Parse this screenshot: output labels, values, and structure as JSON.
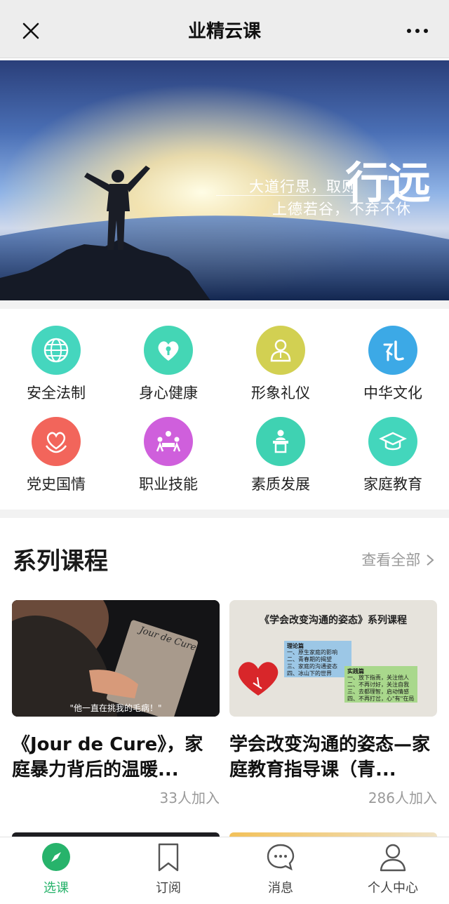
{
  "header": {
    "title": "业精云课",
    "close_icon": "close-icon",
    "more_icon": "more-dots-icon"
  },
  "banner": {
    "line1": "大道行思，取则",
    "line2": "上德若谷，不弃不休",
    "big_text": "行远"
  },
  "categories": [
    {
      "label": "安全法制",
      "icon": "globe-icon",
      "color": "#45d6be"
    },
    {
      "label": "身心健康",
      "icon": "heart-keyhole-icon",
      "color": "#44d6b5"
    },
    {
      "label": "形象礼仪",
      "icon": "person-icon",
      "color": "#d2d052"
    },
    {
      "label": "中华文化",
      "icon": "li-character-icon",
      "color": "#3ca9e6"
    },
    {
      "label": "党史国情",
      "icon": "heart-hands-icon",
      "color": "#f2655b"
    },
    {
      "label": "职业技能",
      "icon": "meeting-icon",
      "color": "#cf5fdc"
    },
    {
      "label": "素质发展",
      "icon": "podium-icon",
      "color": "#3fd2b2"
    },
    {
      "label": "家庭教育",
      "icon": "graduation-cap-icon",
      "color": "#43d6bc"
    }
  ],
  "series": {
    "title": "系列课程",
    "view_all": "查看全部",
    "courses": [
      {
        "title": "《Jour de Cure》，家庭暴力背后的温暖...",
        "joined": "33人加入",
        "thumb_caption": "\"他一直在挑我的毛病！\"",
        "book_text": "Jour de Cure"
      },
      {
        "title": "学会改变沟通的姿态—家庭教育指导课（青...",
        "joined": "286人加入",
        "thumb_heading": "《学会改变沟通的姿态》系列课程",
        "theory_title": "理论篇",
        "theory_items": [
          "一、原生家庭的影响",
          "二、青春期的揭望",
          "三、家庭的沟通姿态",
          "四、冰山下的世界"
        ],
        "practice_title": "实践篇",
        "practice_items": [
          "一、放下指责，关注他人",
          "二、不再讨好，关注自我",
          "三、去都理智，启动情感",
          "四、不再打岔，心\"有\"在局"
        ]
      }
    ]
  },
  "tabbar": {
    "active": 0,
    "tabs": [
      {
        "label": "选课",
        "icon": "compass-icon"
      },
      {
        "label": "订阅",
        "icon": "bookmark-icon"
      },
      {
        "label": "消息",
        "icon": "chat-bubble-icon"
      },
      {
        "label": "个人中心",
        "icon": "user-icon"
      }
    ]
  },
  "colors": {
    "accent": "#27b36b",
    "muted": "#9a9a9a"
  }
}
